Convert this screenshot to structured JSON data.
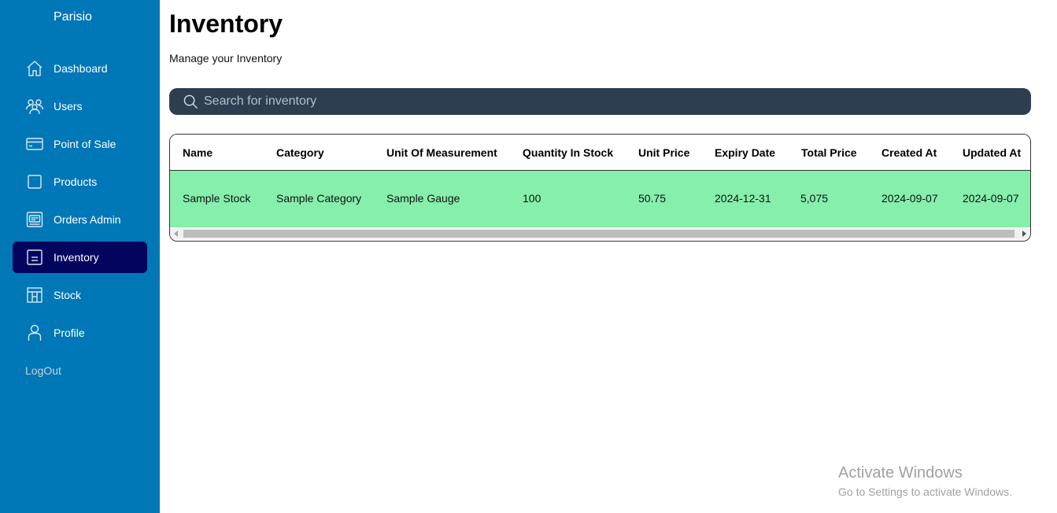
{
  "brand": "Parisio",
  "sidebar": {
    "items": [
      {
        "label": "Dashboard",
        "icon": "home-icon"
      },
      {
        "label": "Users",
        "icon": "users-icon"
      },
      {
        "label": "Point of Sale",
        "icon": "card-icon"
      },
      {
        "label": "Products",
        "icon": "square-icon"
      },
      {
        "label": "Orders Admin",
        "icon": "orders-icon"
      },
      {
        "label": "Inventory",
        "icon": "inventory-icon",
        "active": true
      },
      {
        "label": "Stock",
        "icon": "stock-icon"
      },
      {
        "label": "Profile",
        "icon": "profile-icon"
      }
    ],
    "logout": "LogOut"
  },
  "page": {
    "title": "Inventory",
    "subtitle": "Manage your Inventory"
  },
  "search": {
    "placeholder": "Search for inventory",
    "value": ""
  },
  "table": {
    "columns": [
      "Name",
      "Category",
      "Unit Of Measurement",
      "Quantity In Stock",
      "Unit Price",
      "Expiry Date",
      "Total Price",
      "Created At",
      "Updated At"
    ],
    "rows": [
      [
        "Sample Stock",
        "Sample Category",
        "Sample Gauge",
        "100",
        "50.75",
        "2024-12-31",
        "5,075",
        "2024-09-07",
        "2024-09-07"
      ]
    ]
  },
  "watermark": {
    "title": "Activate Windows",
    "subtitle": "Go to Settings to activate Windows."
  },
  "colors": {
    "sidebar": "#0077b6",
    "sidebar_active": "#03045e",
    "search_bar": "#2d3e50",
    "row_highlight": "#86efac"
  }
}
